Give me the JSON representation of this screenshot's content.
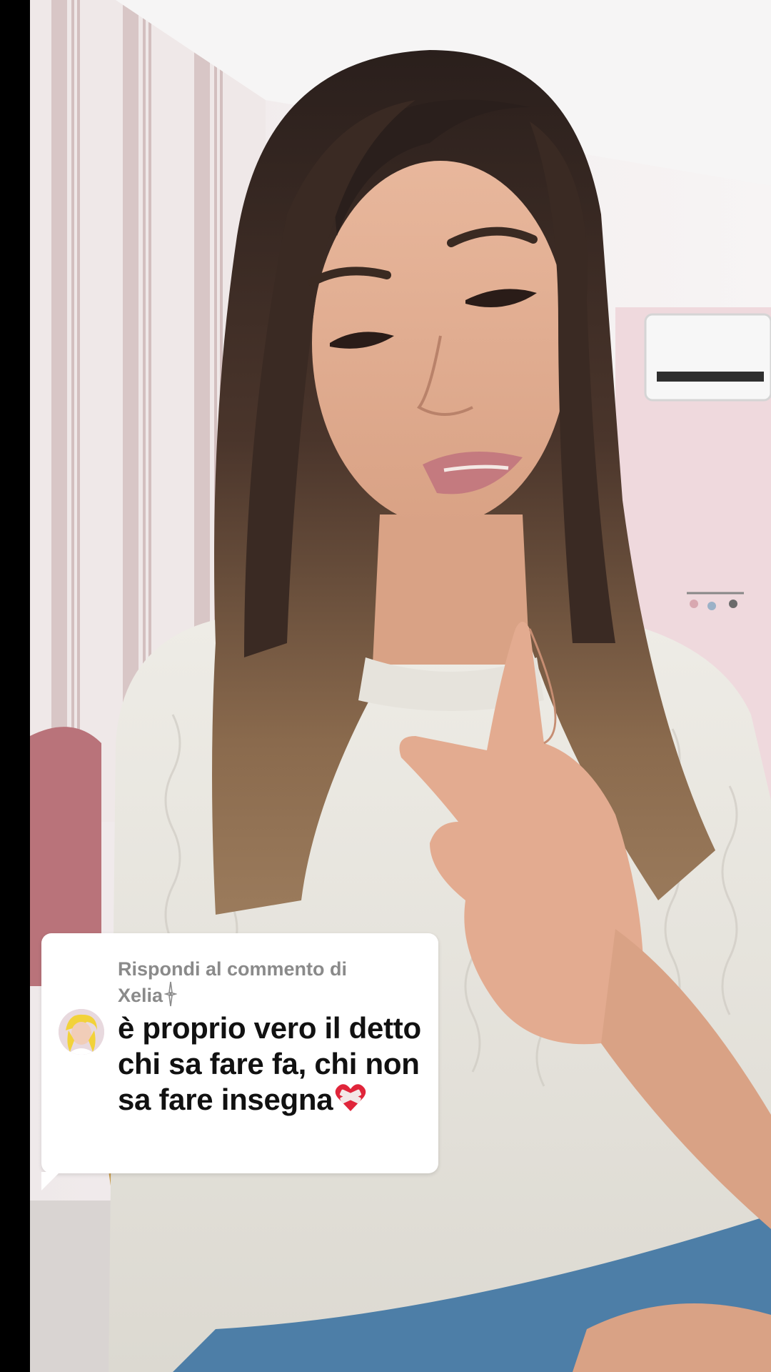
{
  "reply_card": {
    "header_line1": "Rispondi al commento di",
    "header_line2": "Xelia",
    "username_badge": "sparkle-icon",
    "avatar_icon": "user-avatar",
    "comment_text": "è proprio vero il detto chi sa fare fa, chi non sa fare insegna",
    "comment_emoji": "mending-heart-icon"
  },
  "colors": {
    "bubble_bg": "#ffffff",
    "header_text": "#8a8a8a",
    "comment_text": "#111111",
    "heart": "#e0253a"
  }
}
